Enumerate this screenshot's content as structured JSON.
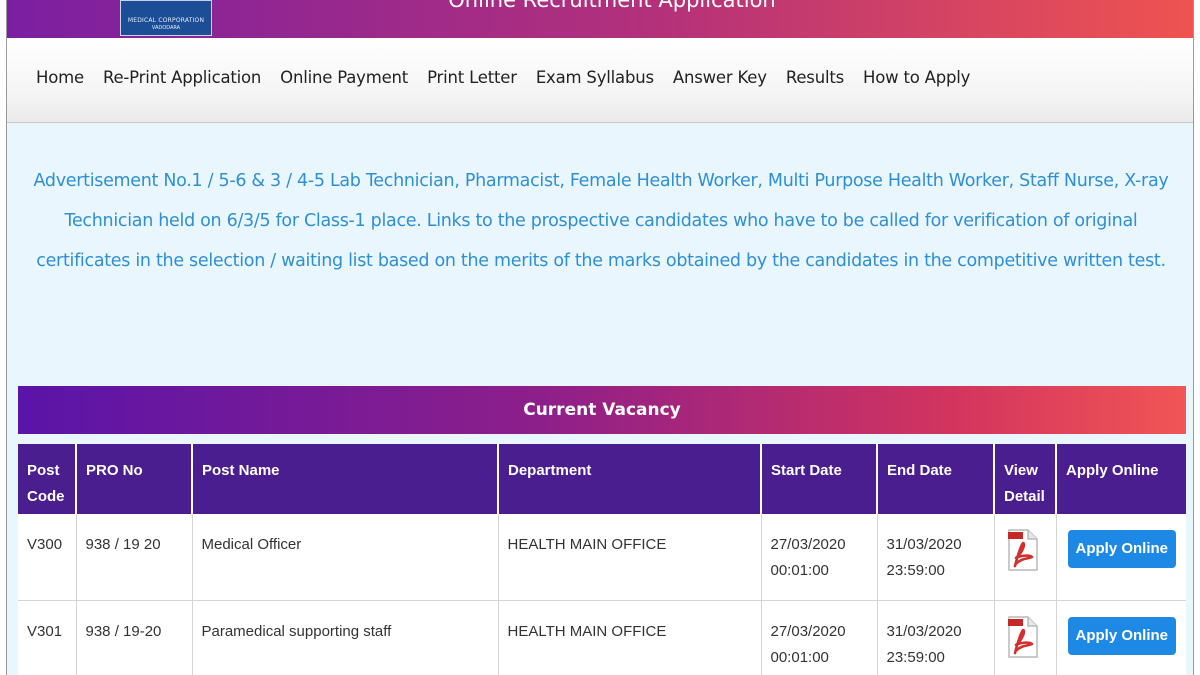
{
  "header": {
    "title": "Online Recruitment Application",
    "logo_line1": "MEDICAL CORPORATION",
    "logo_line2": "VADODARA"
  },
  "nav": {
    "items": [
      {
        "label": "Home"
      },
      {
        "label": "Re-Print Application"
      },
      {
        "label": "Online Payment"
      },
      {
        "label": "Print Letter"
      },
      {
        "label": "Exam Syllabus"
      },
      {
        "label": "Answer Key"
      },
      {
        "label": "Results"
      },
      {
        "label": "How to Apply"
      }
    ]
  },
  "announcement": "Advertisement No.1 / 5-6 & 3 / 4-5 Lab Technician, Pharmacist, Female Health Worker, Multi Purpose Health Worker, Staff Nurse, X-ray Technician held on 6/3/5 for Class-1 place. Links to the prospective candidates who have to be called for verification of original certificates in the selection / waiting list based on the merits of the marks obtained by the candidates in the competitive written test.",
  "vacancy": {
    "title": "Current Vacancy",
    "columns": [
      "Post Code",
      "PRO No",
      "Post Name",
      "Department",
      "Start Date",
      "End Date",
      "View Detail",
      "Apply Online"
    ],
    "rows": [
      {
        "post_code": "V300",
        "pro_no": "938 / 19 20",
        "post_name": "Medical Officer",
        "department": "HEALTH MAIN OFFICE",
        "start_date": "27/03/2020",
        "start_time": "00:01:00",
        "end_date": "31/03/2020",
        "end_time": "23:59:00",
        "view_icon": "pdf-icon",
        "apply_label": "Apply Online"
      },
      {
        "post_code": "V301",
        "pro_no": "938 / 19-20",
        "post_name": "Paramedical supporting staff",
        "department": "HEALTH MAIN OFFICE",
        "start_date": "27/03/2020",
        "start_time": "00:01:00",
        "end_date": "31/03/2020",
        "end_time": "23:59:00",
        "view_icon": "pdf-icon",
        "apply_label": "Apply Online"
      }
    ]
  },
  "colors": {
    "accent_blue": "#2e8fd3",
    "table_header": "#4b1e8f",
    "button_blue": "#1e88e5",
    "content_bg": "#e9f6fd"
  }
}
